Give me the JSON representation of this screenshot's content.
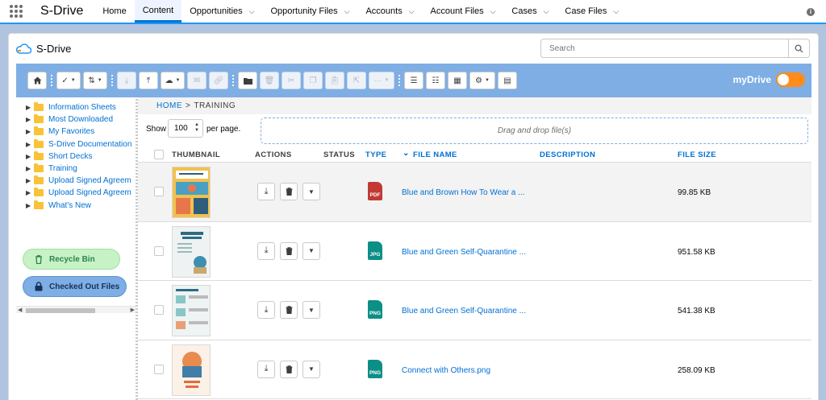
{
  "app": {
    "name": "S-Drive"
  },
  "nav": {
    "items": [
      {
        "label": "Home",
        "chevron": false
      },
      {
        "label": "Content",
        "chevron": false,
        "active": true
      },
      {
        "label": "Opportunities",
        "chevron": true
      },
      {
        "label": "Opportunity Files",
        "chevron": true
      },
      {
        "label": "Accounts",
        "chevron": true
      },
      {
        "label": "Account Files",
        "chevron": true
      },
      {
        "label": "Cases",
        "chevron": true
      },
      {
        "label": "Case Files",
        "chevron": true
      }
    ]
  },
  "card": {
    "title": "S-Drive",
    "search_placeholder": "Search"
  },
  "toolbar": {
    "mydrive_label": "myDrive",
    "mydrive_on": false
  },
  "sidebar": {
    "folders": [
      "Information Sheets",
      "Most Downloaded",
      "My Favorites",
      "S-Drive Documentation",
      "Short Decks",
      "Training",
      "Upload Signed Agreem",
      "Upload Signed Agreem",
      "What's New"
    ],
    "recycle_bin": "Recycle Bin",
    "checked_out": "Checked Out Files"
  },
  "breadcrumb": {
    "home": "HOME",
    "separator": ">",
    "current": "TRAINING"
  },
  "paging": {
    "show_label": "Show",
    "page_size": "100",
    "per_page_label": "per page."
  },
  "dropzone": {
    "text": "Drag and drop file(s)"
  },
  "table": {
    "headers": {
      "thumbnail": "THUMBNAIL",
      "actions": "ACTIONS",
      "status": "STATUS",
      "type": "TYPE",
      "file_name": "FILE NAME",
      "description": "DESCRIPTION",
      "file_size": "FILE SIZE"
    },
    "rows": [
      {
        "type": "PDF",
        "type_color": "#c23934",
        "name": "Blue and Brown How To Wear a ...",
        "size": "99.85 KB",
        "selected": true,
        "thumb_theme": "#f2c14e"
      },
      {
        "type": "JPG",
        "type_color": "#0b8f86",
        "name": "Blue and Green Self-Quarantine ...",
        "size": "951.58 KB",
        "selected": false,
        "thumb_theme": "#eef2f2"
      },
      {
        "type": "PNG",
        "type_color": "#0b8f86",
        "name": "Blue and Green Self-Quarantine ...",
        "size": "541.38 KB",
        "selected": false,
        "thumb_theme": "#eef3f3"
      },
      {
        "type": "PNG",
        "type_color": "#0b8f86",
        "name": "Connect with Others.png",
        "size": "258.09 KB",
        "selected": false,
        "thumb_theme": "#fbf1e6"
      }
    ]
  },
  "colors": {
    "accent": "#0070d2",
    "toolbar": "#7eaee3",
    "toggle": "#ff8c1a"
  }
}
